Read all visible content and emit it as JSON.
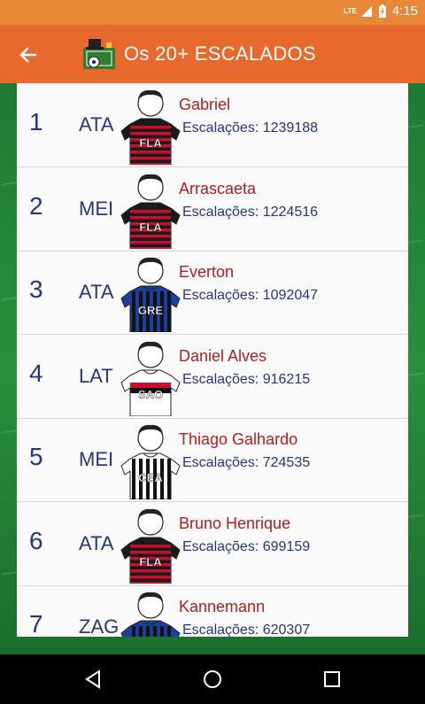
{
  "status": {
    "network": "LTE",
    "time": "4:15"
  },
  "appbar": {
    "title": "Os 20+ ESCALADOS"
  },
  "stats_prefix": "Escalações:",
  "players": [
    {
      "rank": "1",
      "pos": "ATA",
      "name": "Gabriel",
      "count": "1239188",
      "club": "FLA"
    },
    {
      "rank": "2",
      "pos": "MEI",
      "name": "Arrascaeta",
      "count": "1224516",
      "club": "FLA"
    },
    {
      "rank": "3",
      "pos": "ATA",
      "name": "Everton",
      "count": "1092047",
      "club": "GRE"
    },
    {
      "rank": "4",
      "pos": "LAT",
      "name": "Daniel Alves",
      "count": "916215",
      "club": "SAO"
    },
    {
      "rank": "5",
      "pos": "MEI",
      "name": "Thiago Galhardo",
      "count": "724535",
      "club": "CEA"
    },
    {
      "rank": "6",
      "pos": "ATA",
      "name": "Bruno Henrique",
      "count": "699159",
      "club": "FLA"
    },
    {
      "rank": "7",
      "pos": "ZAG",
      "name": "Kannemann",
      "count": "620307",
      "club": "GRE"
    }
  ],
  "colors": {
    "statusbar": "#e8893a",
    "appbar": "#e8692e",
    "name": "#b01f1f",
    "text": "#27367a"
  }
}
